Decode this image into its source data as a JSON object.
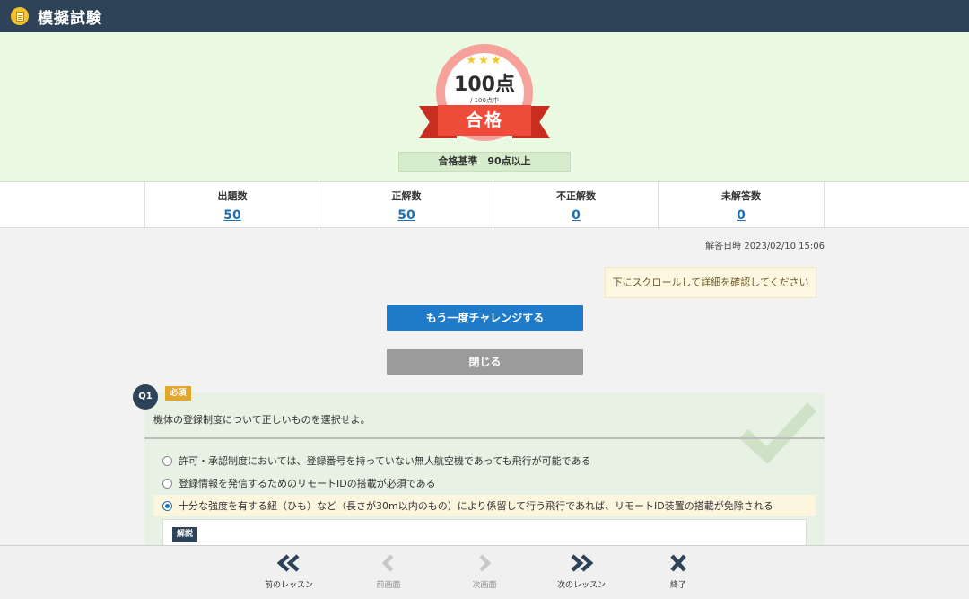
{
  "header": {
    "title": "模擬試験",
    "icon": "document-icon"
  },
  "result": {
    "score": "100点",
    "score_sub": "/ 100点中",
    "stars": "★★★",
    "status": "合格",
    "criteria": "合格基準　90点以上"
  },
  "stats": [
    {
      "label": "出題数",
      "value": "50"
    },
    {
      "label": "正解数",
      "value": "50"
    },
    {
      "label": "不正解数",
      "value": "0"
    },
    {
      "label": "未解答数",
      "value": "0"
    }
  ],
  "answered_at": "解答日時 2023/02/10 15:06",
  "notice": "下にスクロールして詳細を確認してください",
  "buttons": {
    "retry": "もう一度チャレンジする",
    "close": "閉じる"
  },
  "question": {
    "number": "Q1",
    "tag": "必須",
    "text": "機体の登録制度について正しいものを選択せよ。",
    "options": [
      "許可・承認制度においては、登録番号を持っていない無人航空機であっても飛行が可能である",
      "登録情報を発信するためのリモートIDの搭載が必須である",
      "十分な強度を有する紐（ひも）など（長さが30m以内のもの）により係留して行う飛行であれば、リモートID装置の搭載が免除される"
    ],
    "selected_index": 2,
    "explanation_tag": "解説"
  },
  "nav": {
    "prev_lesson": "前のレッスン",
    "prev_screen": "前画面",
    "next_screen": "次画面",
    "next_lesson": "次のレッスン",
    "end": "終了"
  },
  "colors": {
    "header": "#2e4258",
    "hero_bg": "#eaf9e1",
    "ribbon": "#ee4b3b",
    "link": "#1f6fb2",
    "primary_button": "#1f7bc9"
  }
}
